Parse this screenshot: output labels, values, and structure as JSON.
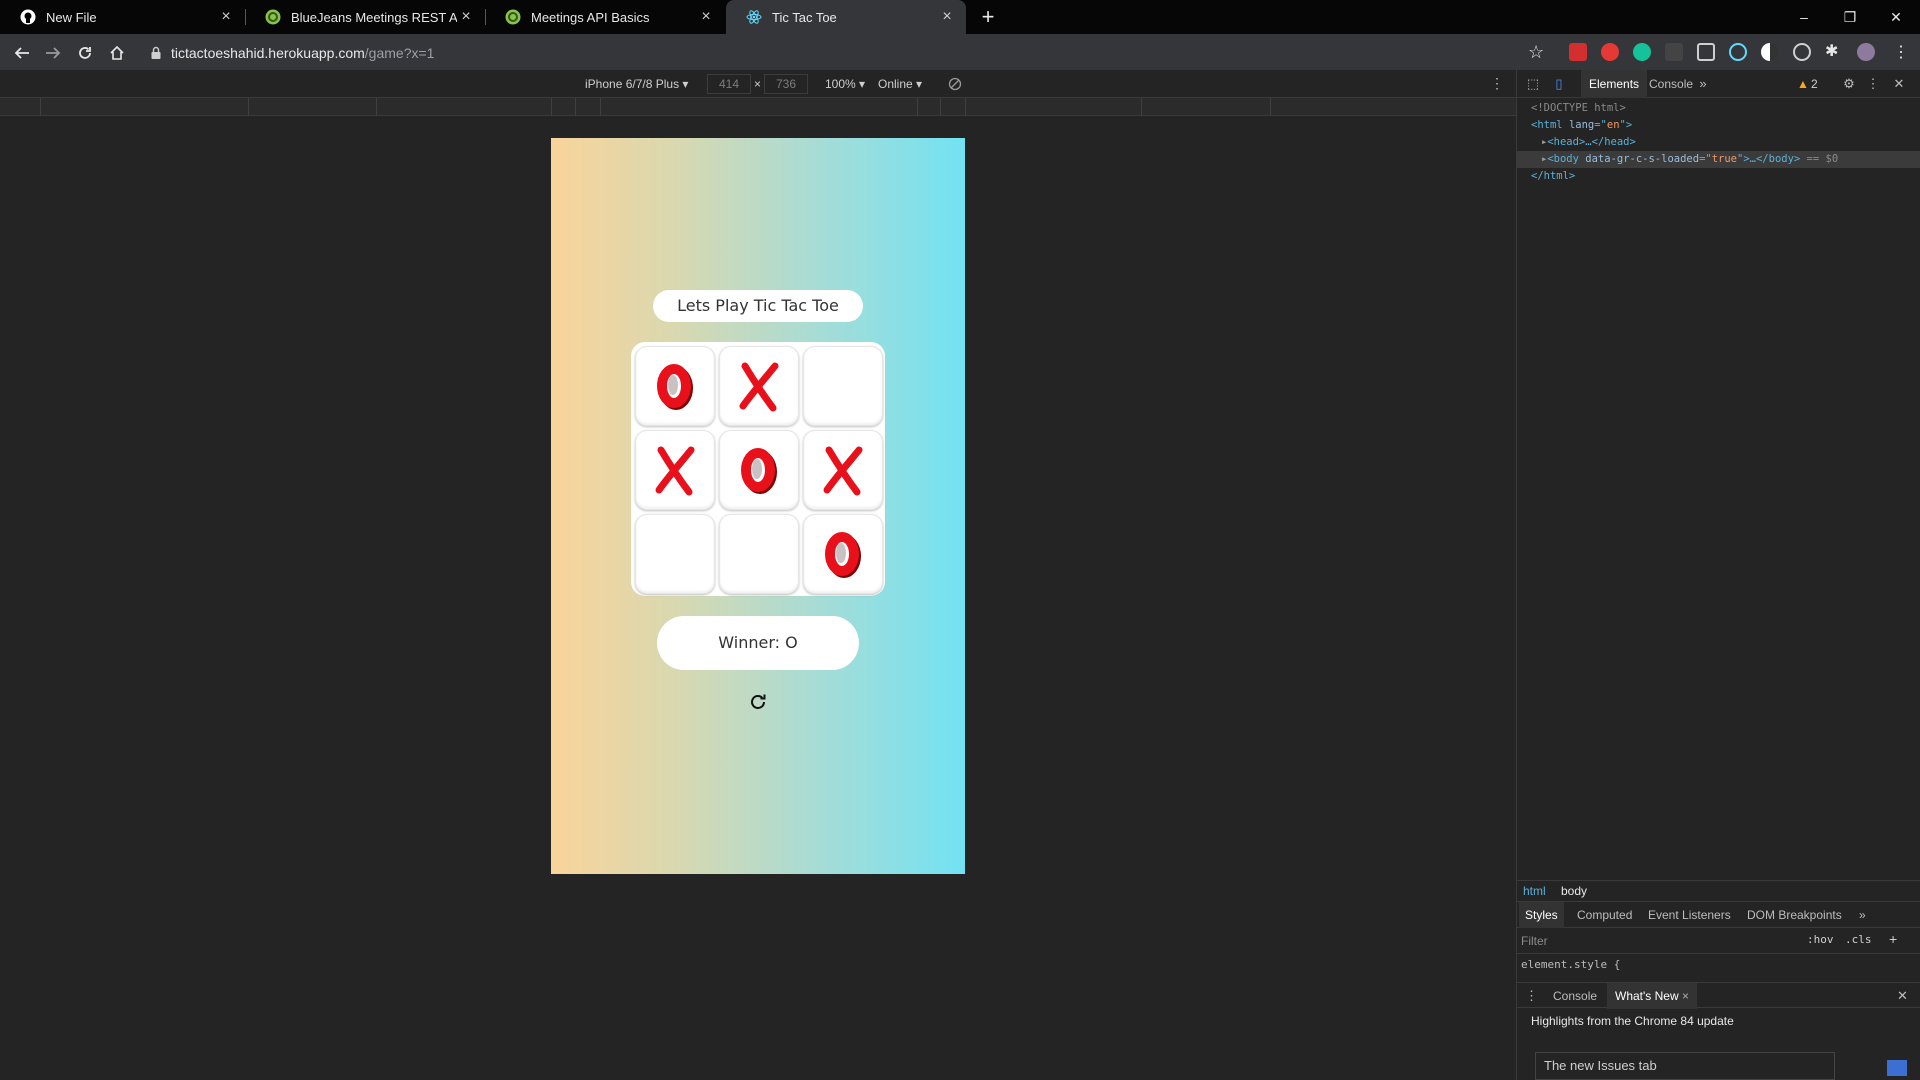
{
  "tabs": [
    {
      "title": "New File",
      "icon": "github-icon",
      "active": false
    },
    {
      "title": "BlueJeans Meetings REST API's",
      "icon": "bluejeans-icon",
      "active": false
    },
    {
      "title": "Meetings API Basics",
      "icon": "bluejeans-icon",
      "active": false
    },
    {
      "title": "Tic Tac Toe",
      "icon": "react-icon",
      "active": true
    }
  ],
  "tab_close_glyph": "×",
  "new_tab_glyph": "+",
  "window_controls": {
    "minimize": "–",
    "maximize": "❐",
    "close": "✕"
  },
  "toolbar": {
    "url_host": "tictactoeshahid.herokuapp.com",
    "url_path": "/game?x=1"
  },
  "device_toolbar": {
    "device": "iPhone 6/7/8 Plus ▾",
    "width": "414",
    "height": "736",
    "times": "×",
    "zoom": "100% ▾",
    "network": "Online ▾"
  },
  "app": {
    "title": "Lets Play Tic Tac Toe",
    "board": [
      "O",
      "X",
      "",
      "X",
      "O",
      "X",
      "",
      "",
      "O"
    ],
    "winner_text": "Winner: O",
    "mark_color": "#e8101a"
  },
  "devtools": {
    "tabs": [
      "Elements",
      "Console"
    ],
    "active_tab": "Elements",
    "more_glyph": "»",
    "warnings": "2",
    "elements_lines": {
      "l1": "<!DOCTYPE html>",
      "l2_tag_open": "<html ",
      "l2_attr": "lang",
      "l2_eq": "=\"",
      "l2_val": "en",
      "l2_close": "\">",
      "l3": "<head>…</head>",
      "l4_tag_open": "<body ",
      "l4_attr": "data-gr-c-s-loaded",
      "l4_eq": "=\"",
      "l4_val": "true",
      "l4_close": "\">…</body>",
      "l4_suffix": " == $0",
      "l5": "</html>"
    },
    "breadcrumbs": [
      "html",
      "body"
    ],
    "style_tabs": [
      "Styles",
      "Computed",
      "Event Listeners",
      "DOM Breakpoints"
    ],
    "filter_placeholder": "Filter",
    "hov": ":hov",
    "cls": ".cls",
    "plus": "+",
    "element_style": "element.style {",
    "drawer_tabs": [
      "Console",
      "What's New"
    ],
    "drawer_close": "×",
    "highlights": "Highlights from the Chrome 84 update",
    "issues_card": "The new Issues tab"
  }
}
